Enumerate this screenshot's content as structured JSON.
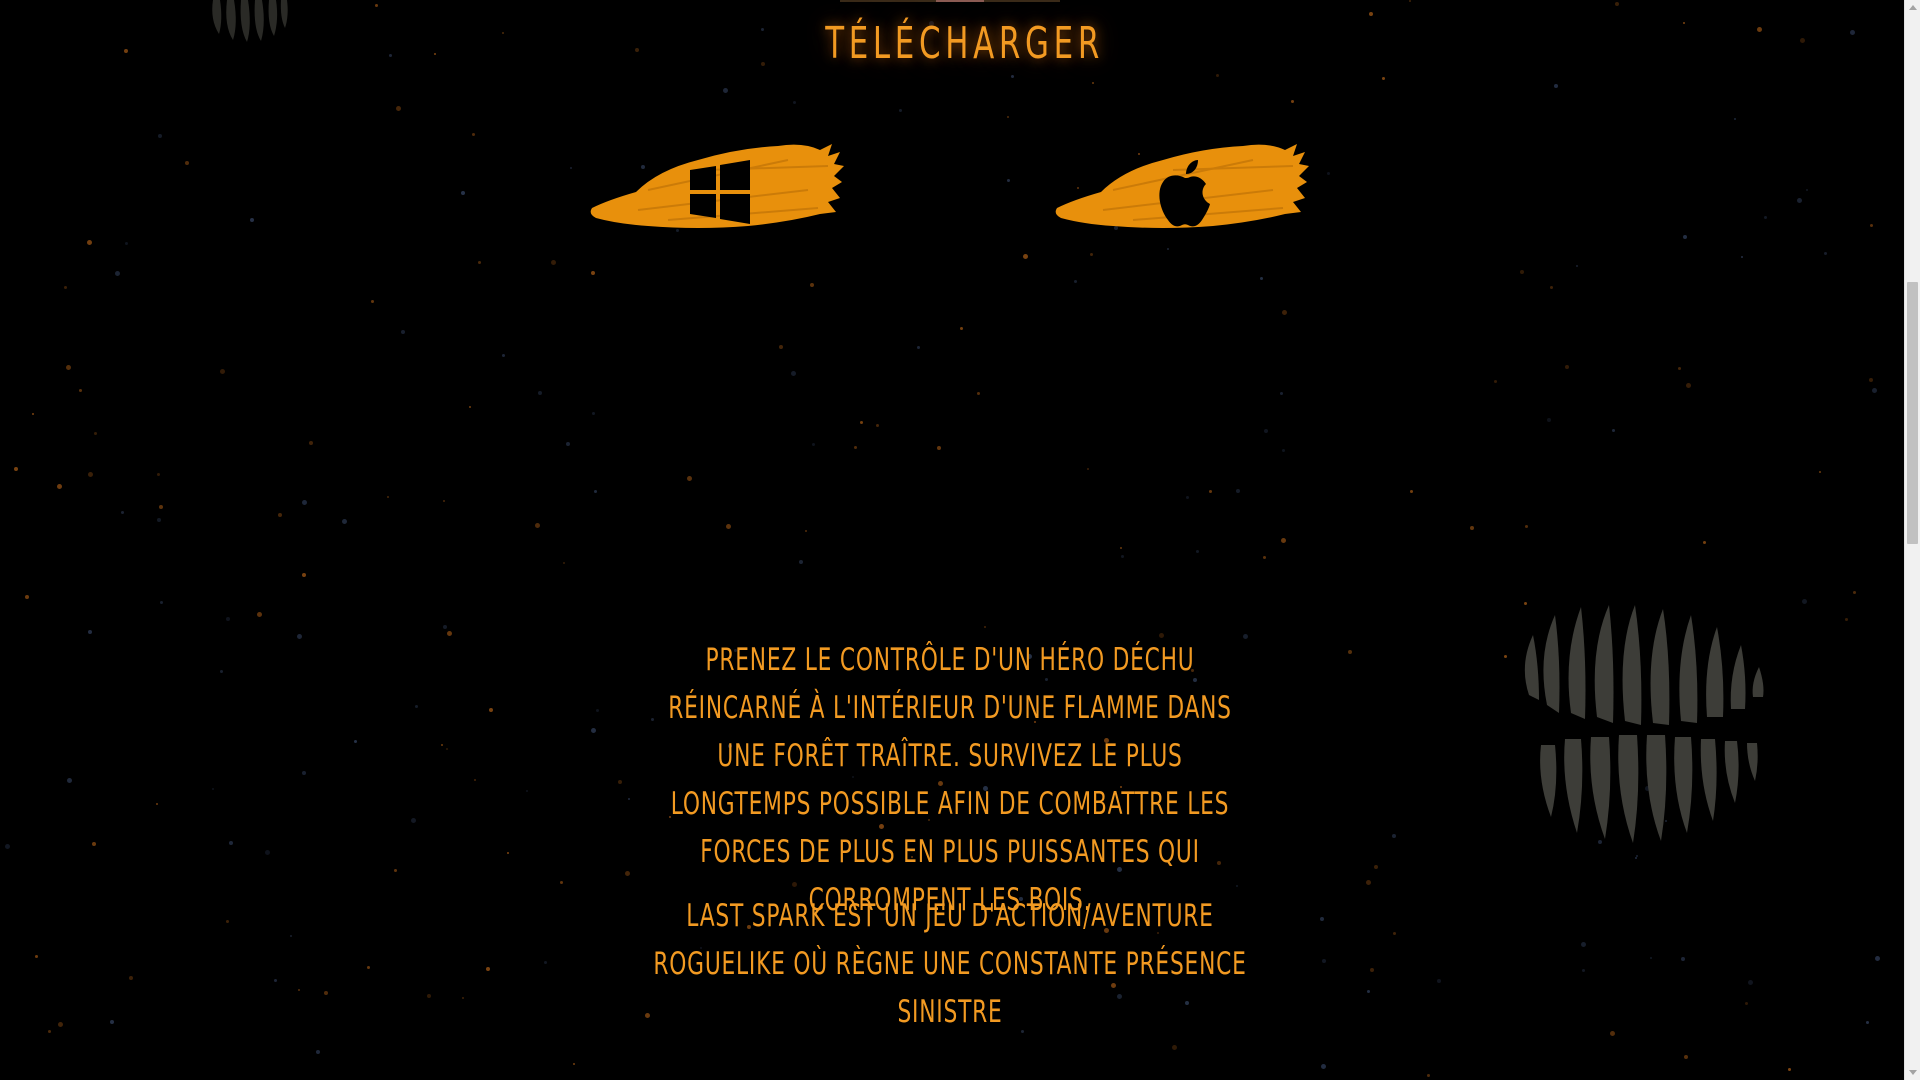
{
  "page": {
    "section_title": "TÉLÉCHARGER",
    "downloads": [
      {
        "platform": "Windows",
        "icon": "windows-logo-icon"
      },
      {
        "platform": "macOS",
        "icon": "apple-logo-icon"
      }
    ],
    "description_paragraph_1": "Prenez le contrôle d'un héro déchu réincarné à l'intérieur d'une flamme dans une forêt traître. Survivez le plus longtemps possible afin de combattre les forces de plus en plus puissantes qui corrompent les bois.",
    "description_paragraph_2": "Last Spark est un jeu d'action/aventure roguelike où règne une constante présence sinistre"
  },
  "colors": {
    "background": "#000000",
    "accent_orange": "#f29a22",
    "brush_orange": "#e8900c",
    "teeth_gray": "#3d3d38",
    "scrollbar_track": "#f1f1f1",
    "scrollbar_thumb": "#c1c1c1"
  }
}
